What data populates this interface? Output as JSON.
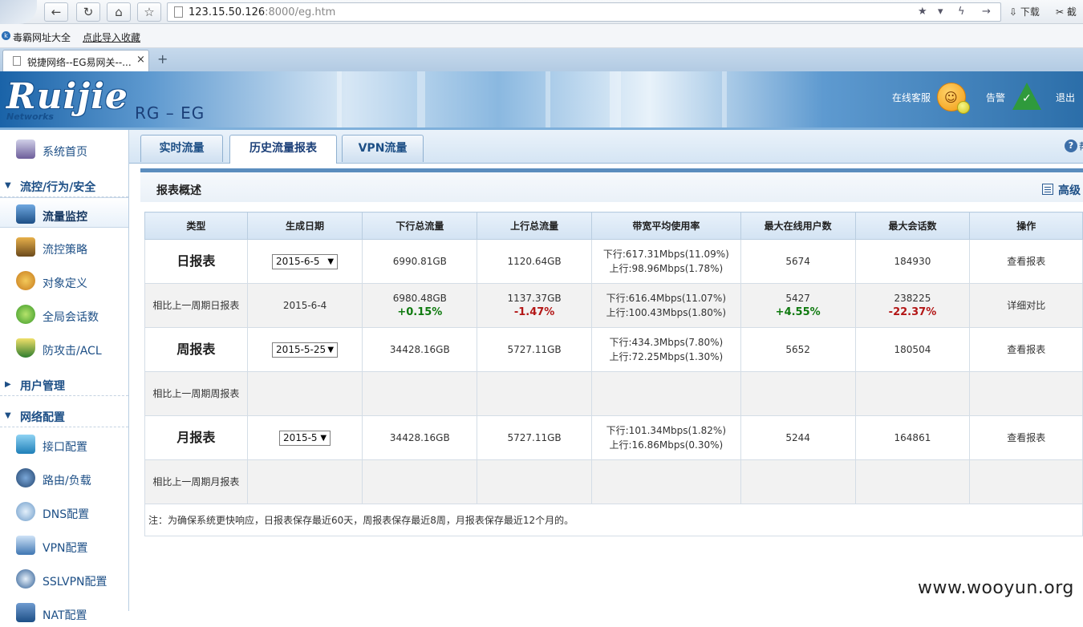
{
  "browser": {
    "url_host": "123.15.50.126",
    "url_path": ":8000/eg.htm",
    "download_label": "下载",
    "screenshot_label": "截",
    "bookmarks": [
      "毒霸网址大全",
      "点此导入收藏"
    ],
    "tab_title": "锐捷网络--EG易网关--...",
    "tab_close": "×",
    "new_tab": "+"
  },
  "header": {
    "logo": "Ruijie",
    "logo_sub": "Networks",
    "product": "RG – EG",
    "online_support": "在线客服",
    "alarm": "告警",
    "logout": "退出"
  },
  "sidebar": {
    "top_item": "系统首页",
    "sections": [
      {
        "label": "流控/行为/安全",
        "expanded": true,
        "items": [
          "流量监控",
          "流控策略",
          "对象定义",
          "全局会话数",
          "防攻击/ACL"
        ],
        "active": "流量监控"
      },
      {
        "label": "用户管理",
        "expanded": false,
        "items": []
      },
      {
        "label": "网络配置",
        "expanded": true,
        "items": [
          "接口配置",
          "路由/负载",
          "DNS配置",
          "VPN配置",
          "SSLVPN配置",
          "NAT配置"
        ]
      }
    ]
  },
  "main": {
    "tabs": [
      "实时流量",
      "历史流量报表",
      "VPN流量"
    ],
    "active_tab": "历史流量报表",
    "help_label": "帮",
    "panel_title": "报表概述",
    "advanced_label": "高级",
    "table": {
      "headers": [
        "类型",
        "生成日期",
        "下行总流量",
        "上行总流量",
        "带宽平均使用率",
        "最大在线用户数",
        "最大会话数",
        "操作"
      ],
      "rows": [
        {
          "type": "日报表",
          "date": "2015-6-5",
          "down": "6990.81GB",
          "up": "1120.64GB",
          "bw_down": "下行:617.31Mbps(11.09%)",
          "bw_up": "上行:98.96Mbps(1.78%)",
          "users": "5674",
          "sessions": "184930",
          "action": "查看报表"
        },
        {
          "type": "相比上一周期日报表",
          "date": "2015-6-4",
          "down": "6980.48GB",
          "down_change": "+0.15%",
          "up": "1137.37GB",
          "up_change": "-1.47%",
          "bw_down": "下行:616.4Mbps(11.07%)",
          "bw_up": "上行:100.43Mbps(1.80%)",
          "users": "5427",
          "users_change": "+4.55%",
          "sessions": "238225",
          "sessions_change": "-22.37%",
          "action": "详细对比"
        },
        {
          "type": "周报表",
          "date": "2015-5-25",
          "down": "34428.16GB",
          "up": "5727.11GB",
          "bw_down": "下行:434.3Mbps(7.80%)",
          "bw_up": "上行:72.25Mbps(1.30%)",
          "users": "5652",
          "sessions": "180504",
          "action": "查看报表"
        },
        {
          "type": "相比上一周期周报表"
        },
        {
          "type": "月报表",
          "date": "2015-5",
          "down": "34428.16GB",
          "up": "5727.11GB",
          "bw_down": "下行:101.34Mbps(1.82%)",
          "bw_up": "上行:16.86Mbps(0.30%)",
          "users": "5244",
          "sessions": "164861",
          "action": "查看报表"
        },
        {
          "type": "相比上一周期月报表"
        }
      ],
      "note": "注：为确保系统更快响应，日报表保存最近60天，周报表保存最近8周，月报表保存最近12个月的。"
    }
  },
  "watermark": "www.wooyun.org",
  "colors": {
    "accent": "#1d4f86",
    "positive": "#0f7a0f",
    "negative": "#b31616",
    "header_blue": "#1a63a8"
  }
}
